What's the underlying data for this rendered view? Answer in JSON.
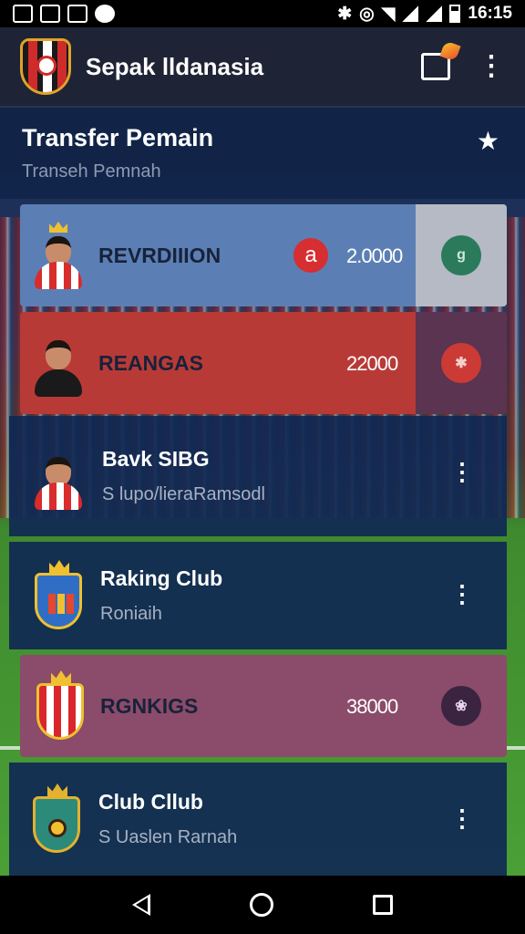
{
  "status_bar": {
    "time": "16:15"
  },
  "app_bar": {
    "title": "Sepak lldanasia",
    "share_icon": "share-icon",
    "menu_icon": "overflow-menu-icon"
  },
  "header": {
    "title": "Transfer Pemain",
    "subtitle": "Transeh Pemnah",
    "star_icon": "star-icon"
  },
  "rows": [
    {
      "name": "REVRDIIION",
      "badge": "a",
      "value": "2.0000",
      "bg": "#5b7fb4",
      "side_bg": "#b6bac4",
      "seal_bg": "#2b7a5c",
      "seal_text": "g"
    },
    {
      "name": "REANGAS",
      "value": "22000",
      "bg": "#b83a37",
      "side_bg": "#5a3450",
      "seal_bg": "#cc3a36",
      "seal_text": "✱"
    },
    {
      "name": "Bavk SIBG",
      "sub": "S lupo/lieraRamsodl"
    },
    {
      "name": "Raking Club",
      "sub": "Roniaih"
    },
    {
      "name": "RGNKIGS",
      "value": "38000",
      "bg": "#8b4b6a",
      "seal_bg": "#3a2440",
      "seal_text": "❀"
    },
    {
      "name": "Club Cllub",
      "sub": "S Uaslen Rarnah"
    }
  ],
  "nav_bar": {
    "back_icon": "back-icon",
    "home_icon": "home-icon",
    "recents_icon": "recents-icon"
  },
  "colors": {
    "app_bar": "#1e2436",
    "list_bg": "#10284f",
    "accent_red": "#d62e31"
  }
}
